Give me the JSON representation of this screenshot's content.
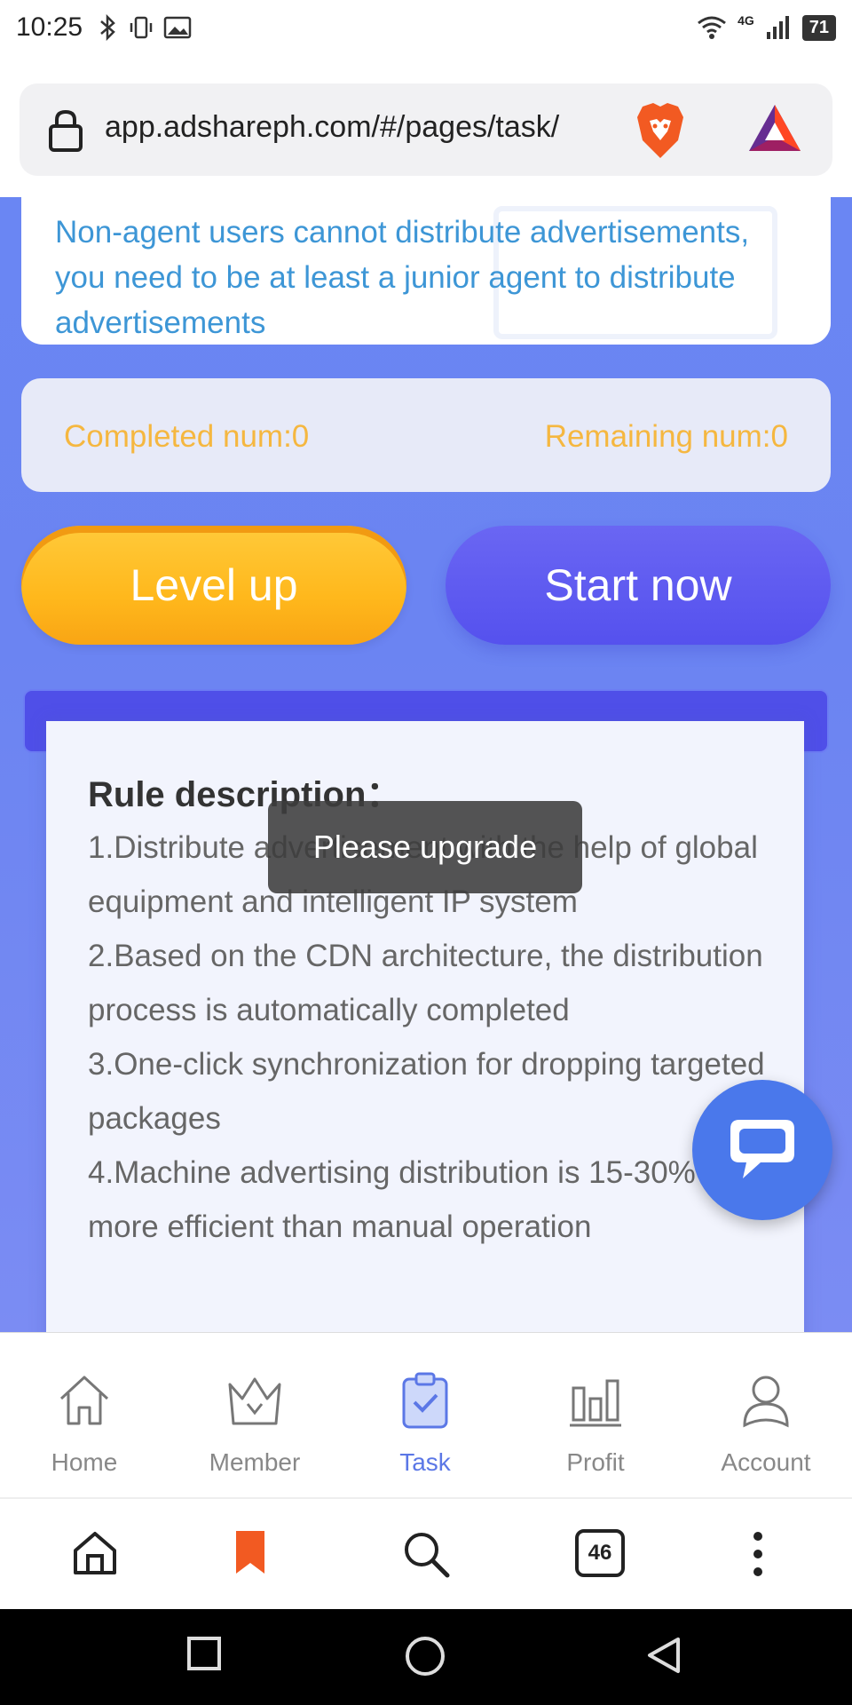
{
  "status_bar": {
    "time": "10:25",
    "network": "4G",
    "battery": "71"
  },
  "browser": {
    "url": "app.adshareph.com/#/pages/task/",
    "tabs_count": "46"
  },
  "notice": {
    "text": "Non-agent users cannot distribute advertisements, you need to be at least a junior agent to distribute advertisements"
  },
  "counts": {
    "completed": "Completed num:0",
    "remaining": "Remaining num:0"
  },
  "buttons": {
    "level_up": "Level up",
    "start_now": "Start now"
  },
  "rules": {
    "title": "Rule description：",
    "items": [
      "1.Distribute advertisement with the help of global equipment and intelligent IP system",
      "2.Based on the CDN architecture, the distribution process is automatically completed",
      "3.One-click synchronization for dropping targeted packages",
      "4.Machine advertising distribution is 15-30% more efficient than manual operation"
    ]
  },
  "toast": {
    "text": "Please upgrade"
  },
  "tabbar": {
    "items": [
      {
        "label": "Home",
        "icon": "home-icon"
      },
      {
        "label": "Member",
        "icon": "crown-icon"
      },
      {
        "label": "Task",
        "icon": "clipboard-check-icon",
        "active": true
      },
      {
        "label": "Profit",
        "icon": "bar-chart-icon"
      },
      {
        "label": "Account",
        "icon": "user-icon"
      }
    ]
  },
  "colors": {
    "accent": "#5b77e6",
    "notice_text": "#3d96d6",
    "count_text": "#f5b740",
    "level_up": "#ffb81c",
    "start_now": "#5551ee"
  }
}
